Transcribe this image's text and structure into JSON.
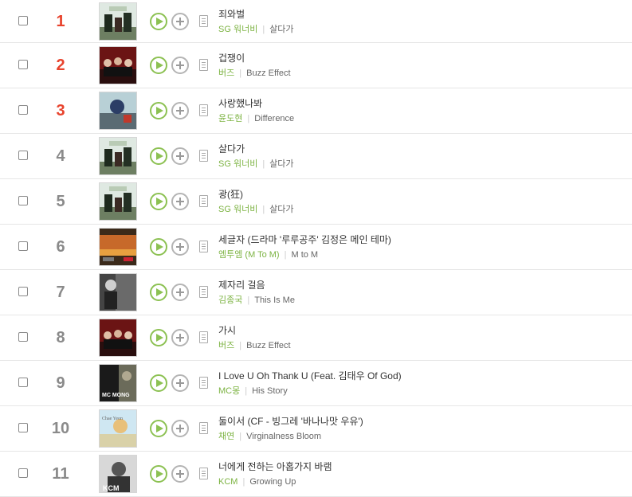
{
  "chart": {
    "rows": [
      {
        "rank": "1",
        "top": true,
        "title": "죄와벌",
        "artist": "SG 워너비",
        "album": "살다가",
        "cover": "sg"
      },
      {
        "rank": "2",
        "top": true,
        "title": "겁쟁이",
        "artist": "버즈",
        "album": "Buzz Effect",
        "cover": "buzz"
      },
      {
        "rank": "3",
        "top": true,
        "title": "사랑했나봐",
        "artist": "윤도현",
        "album": "Difference",
        "cover": "yoon"
      },
      {
        "rank": "4",
        "top": false,
        "title": "살다가",
        "artist": "SG 워너비",
        "album": "살다가",
        "cover": "sg"
      },
      {
        "rank": "5",
        "top": false,
        "title": "광(狂)",
        "artist": "SG 워너비",
        "album": "살다가",
        "cover": "sg"
      },
      {
        "rank": "6",
        "top": false,
        "title": "세글자 (드라마 '루루공주' 김정은 메인 테마)",
        "artist": "엠투엠 (M To M)",
        "album": "M to M",
        "cover": "m2m"
      },
      {
        "rank": "7",
        "top": false,
        "title": "제자리 걸음",
        "artist": "김종국",
        "album": "This Is Me",
        "cover": "kim"
      },
      {
        "rank": "8",
        "top": false,
        "title": "가시",
        "artist": "버즈",
        "album": "Buzz Effect",
        "cover": "buzz"
      },
      {
        "rank": "9",
        "top": false,
        "title": "I Love U Oh Thank U (Feat. 김태우 Of God)",
        "artist": "MC몽",
        "album": "His Story",
        "cover": "mcmong"
      },
      {
        "rank": "10",
        "top": false,
        "title": "둘이서 (CF - 빙그레 '바나나맛 우유')",
        "artist": "채연",
        "album": "Virginalness Bloom",
        "cover": "chae"
      },
      {
        "rank": "11",
        "top": false,
        "title": "너에게 전하는 아홉가지 바램",
        "artist": "KCM",
        "album": "Growing Up",
        "cover": "kcm"
      }
    ],
    "cover_text": {
      "mcmong": "MC MONG",
      "chae": "Chae Yeon",
      "kcm": "KCM"
    }
  },
  "colors": {
    "rank_top": "#e8432d",
    "rank_normal": "#8a8a8a",
    "accent_green": "#8cc152",
    "artist_green": "#7cb342"
  },
  "icons": {
    "play": "play-icon",
    "add": "plus-icon",
    "lyrics": "lyrics-document-icon",
    "select": "checkbox"
  }
}
